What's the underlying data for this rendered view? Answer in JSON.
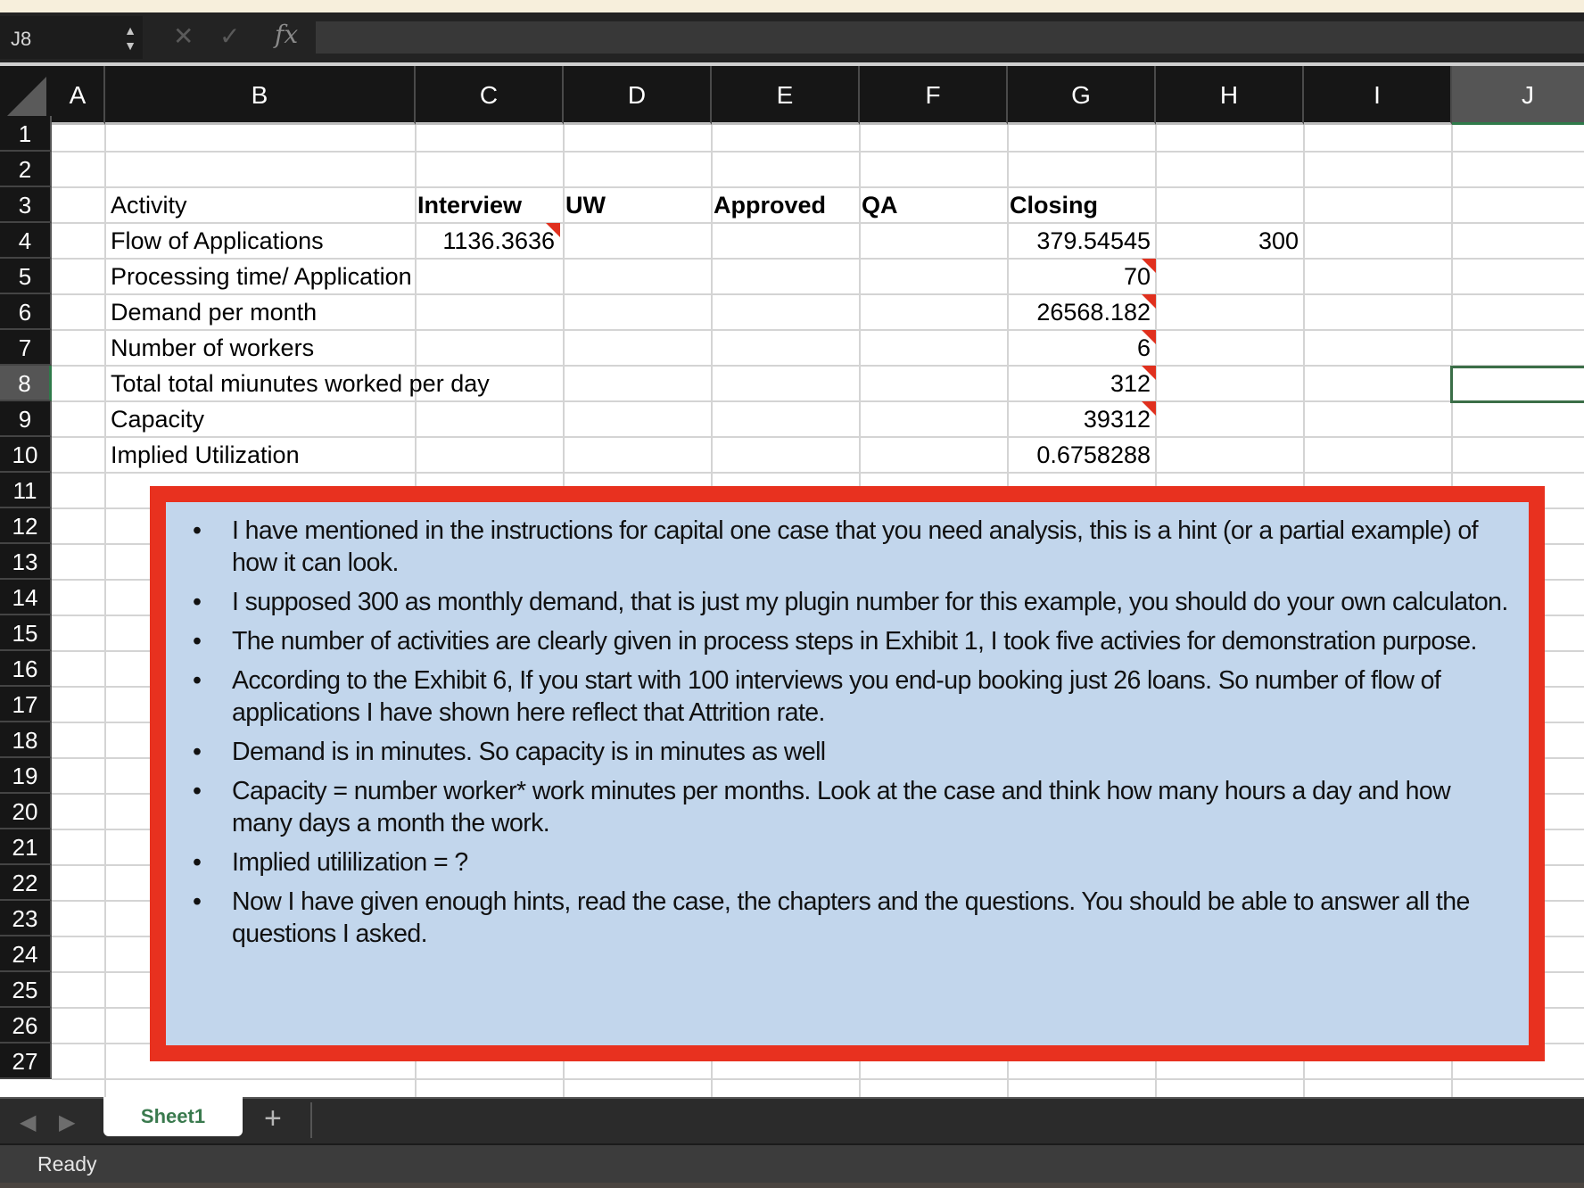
{
  "app": {
    "name_box": "J8",
    "formula_content": "",
    "formula_buttons": {
      "cancel_icon": "close-icon",
      "enter_icon": "checkmark-icon",
      "function_label": "fx"
    }
  },
  "columns": [
    "A",
    "B",
    "C",
    "D",
    "E",
    "F",
    "G",
    "H",
    "I",
    "J"
  ],
  "selected_column": "J",
  "rows": [
    "1",
    "2",
    "3",
    "4",
    "5",
    "6",
    "7",
    "8",
    "9",
    "10",
    "11",
    "12",
    "13",
    "14",
    "15",
    "16",
    "17",
    "18",
    "19",
    "20",
    "21",
    "22",
    "23",
    "24",
    "25",
    "26",
    "27"
  ],
  "selected_row": "8",
  "selected_cell": "J8",
  "table": {
    "header": {
      "label": "Activity",
      "stages": [
        "Interview",
        "UW",
        "Approved",
        "QA",
        "Closing"
      ]
    },
    "row_labels": [
      "Flow of Applications",
      "Processing time/ Application",
      "Demand per month",
      "Number of workers",
      "Total total miunutes worked per day",
      "Capacity",
      "Implied Utilization"
    ],
    "values": {
      "interview_flow": "1136.3636",
      "closing_flow": "379.54545",
      "monthly_demand_input": "300",
      "closing_processing_time": "70",
      "closing_demand_per_month": "26568.182",
      "closing_workers": "6",
      "closing_minutes_per_day": "312",
      "closing_capacity": "39312",
      "closing_utilization": "0.6758288"
    }
  },
  "note": {
    "bullets": [
      "I have mentioned in the instructions for capital one case that you need analysis, this is a hint (or a partial example) of how it can look.",
      " I supposed 300 as monthly demand, that is just my plugin number for this example, you should do your own calculaton.",
      "The number of activities are clearly given in process steps in Exhibit 1, I took five activies for demonstration purpose.",
      "According to the Exhibit 6, If you start with 100 interviews you end-up booking just 26 loans. So number of flow of applications I have shown here reflect that Attrition rate.",
      "Demand is in minutes. So capacity is in minutes as well",
      "Capacity = number worker* work minutes per months. Look at the case and think how many hours a day and how many days a month the work.",
      "Implied utililization = ?",
      "Now I have given enough hints, read the case, the chapters and the questions. You should be able to answer all the questions I asked."
    ],
    "bullet_char": "•",
    "colors": {
      "border": "#e8311f",
      "fill": "#c2d6ec"
    }
  },
  "sheets": {
    "tabs": [
      "Sheet1"
    ],
    "active": "Sheet1",
    "add_label": "+",
    "prev_label": "◀",
    "next_label": "▶"
  },
  "status": {
    "text": "Ready"
  },
  "colors": {
    "accent_green": "#3b6e47",
    "comment_marker": "#e0301e"
  }
}
